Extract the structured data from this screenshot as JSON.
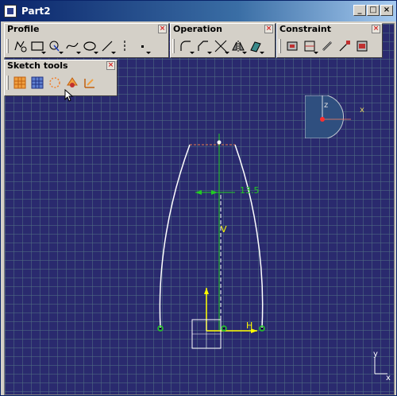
{
  "window": {
    "title": "Part2",
    "minimize": "_",
    "maximize": "□",
    "close": "×"
  },
  "toolbars": {
    "profile": {
      "title": "Profile",
      "close": "×",
      "tools": [
        "profile-icon",
        "rectangle-icon",
        "point-icon",
        "spline-icon",
        "ellipse-icon",
        "line-icon",
        "axis-icon",
        "point-dot-icon"
      ]
    },
    "operation": {
      "title": "Operation",
      "close": "×",
      "tools": [
        "corner-icon",
        "chamfer-icon",
        "trim-icon",
        "mirror-icon",
        "project-3d-icon"
      ]
    },
    "constraint": {
      "title": "Constraint",
      "close": "×",
      "tools": [
        "constraint-dialog-icon",
        "constraint-icon",
        "fix-together-icon",
        "auto-constraint-icon",
        "animate-constraint-icon"
      ]
    },
    "sketch_tools": {
      "title": "Sketch tools",
      "close": "×",
      "tools": [
        "grid-icon",
        "snap-to-point-icon",
        "construction-icon",
        "geometrical-constraints-icon",
        "dimensional-constraints-icon"
      ]
    }
  },
  "sketch": {
    "dimension_label": "13.5",
    "h_label": "H",
    "v_label": "V",
    "compass_z": "z",
    "compass_x": "x",
    "axis_x": "x",
    "axis_y": "y"
  },
  "colors": {
    "background": "#2a2a6e",
    "grid": "#4e6e82",
    "geometry": "#ffffff",
    "axis": "#ffff00",
    "dimension": "#22cc22",
    "compass": "#2f4f7f"
  }
}
